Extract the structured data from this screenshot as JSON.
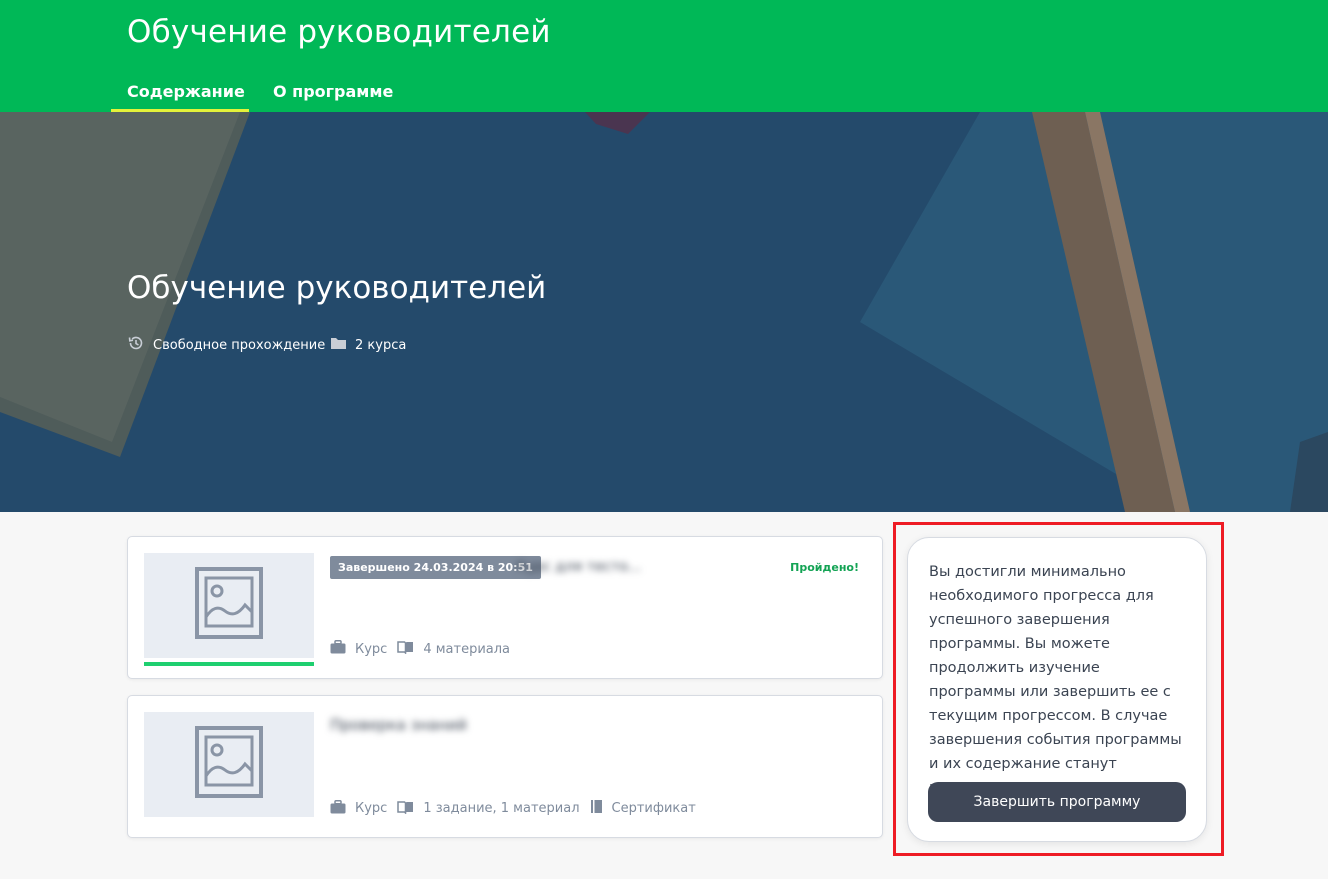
{
  "header": {
    "title": "Обучение руководителей",
    "tabs": [
      {
        "label": "Содержание",
        "active": true
      },
      {
        "label": "О программе",
        "active": false
      }
    ],
    "colors": {
      "bar": "#00b857",
      "active_tab_underline": "#e4f23a"
    }
  },
  "hero": {
    "title": "Обучение руководителей",
    "meta": [
      {
        "icon": "history-icon",
        "label": "Свободное прохождение"
      },
      {
        "icon": "folder-icon",
        "label": "2 курса"
      }
    ]
  },
  "courses": [
    {
      "thumbnail_icon": "image-placeholder-icon",
      "badge": "Завершено 24.03.2024 в 20:51",
      "title": "Курс для тесто...",
      "status": "Пройдено!",
      "progress": 1.0,
      "meta": [
        {
          "icon": "briefcase-icon",
          "label": "Курс"
        },
        {
          "icon": "book-icon",
          "label": "4 материала"
        }
      ]
    },
    {
      "thumbnail_icon": "image-placeholder-icon",
      "title": "Проверка знаний",
      "meta": [
        {
          "icon": "briefcase-icon",
          "label": "Курс"
        },
        {
          "icon": "book-icon",
          "label": "1 задание, 1 материал"
        },
        {
          "icon": "certificate-icon",
          "label": "Сертификат"
        }
      ]
    }
  ],
  "info_panel": {
    "text": "Вы достигли минимально необходимого прогресса для успешного завершения программы. Вы можете продолжить изучение программы или завершить ее с текущим прогрессом. В случае завершения события программы и их содержание станут недоступны.",
    "button_label": "Завершить программу",
    "highlight_color": "#ee1c25"
  }
}
